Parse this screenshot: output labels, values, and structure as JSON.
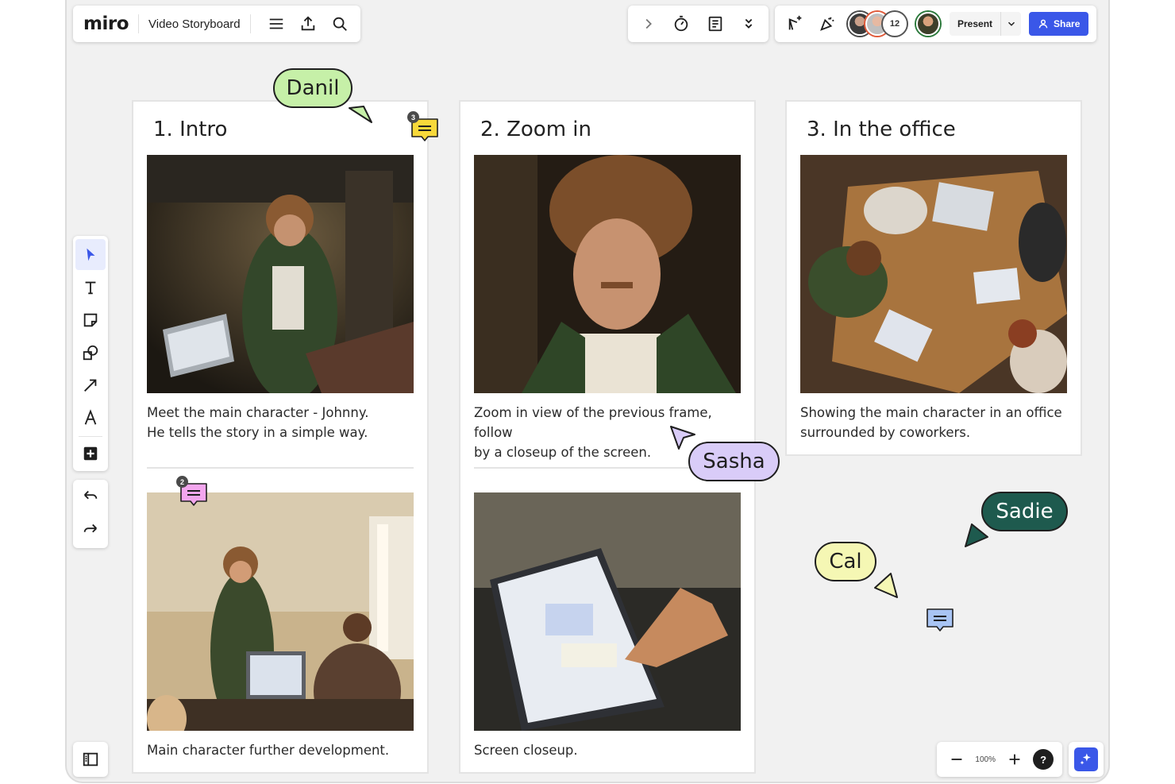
{
  "app": {
    "logo": "miro",
    "board_title": "Video Storyboard"
  },
  "topbar": {
    "left_icons": [
      "menu-icon",
      "export-icon",
      "search-icon"
    ],
    "mid_icons": [
      "chevron-right-icon",
      "timer-icon",
      "notes-icon",
      "double-chevron-down-icon"
    ],
    "right_icons": [
      "reactions-icon",
      "celebrate-icon"
    ],
    "collaborator_count": "12",
    "present_label": "Present",
    "share_label": "Share"
  },
  "toolbar": {
    "tools": [
      "select-icon",
      "text-icon",
      "sticky-note-icon",
      "shapes-icon",
      "arrow-icon",
      "pen-icon",
      "add-more-icon"
    ],
    "history": [
      "undo-icon",
      "redo-icon"
    ]
  },
  "zoom": {
    "level": "100%",
    "help": "?"
  },
  "frames": [
    {
      "title": "1. Intro",
      "scenes": [
        {
          "caption_line1": "Meet the main character - Johnny.",
          "caption_line2": "He tells the story in a simple way."
        },
        {
          "caption_line1": "Main character further development.",
          "caption_line2": ""
        }
      ]
    },
    {
      "title": "2. Zoom in",
      "scenes": [
        {
          "caption_line1": "Zoom in view of the previous frame, follow",
          "caption_line2": "by a closeup of the screen."
        },
        {
          "caption_line1": "Screen closeup.",
          "caption_line2": ""
        }
      ]
    },
    {
      "title": "3. In the office",
      "scenes": [
        {
          "caption_line1": "Showing the main character in an office",
          "caption_line2": "surrounded by coworkers."
        }
      ]
    }
  ],
  "cursors": [
    {
      "name": "Danil",
      "color": "#c6f0a8"
    },
    {
      "name": "Sasha",
      "color": "#d9ccf8"
    },
    {
      "name": "Sadie",
      "color": "#1e5a4e"
    },
    {
      "name": "Cal",
      "color": "#f5f7b4"
    }
  ],
  "comments": [
    {
      "count": "3",
      "color": "#f8d93a"
    },
    {
      "count": "2",
      "color": "#f3a6ee"
    },
    {
      "count": "",
      "color": "#a8c4f4"
    }
  ]
}
